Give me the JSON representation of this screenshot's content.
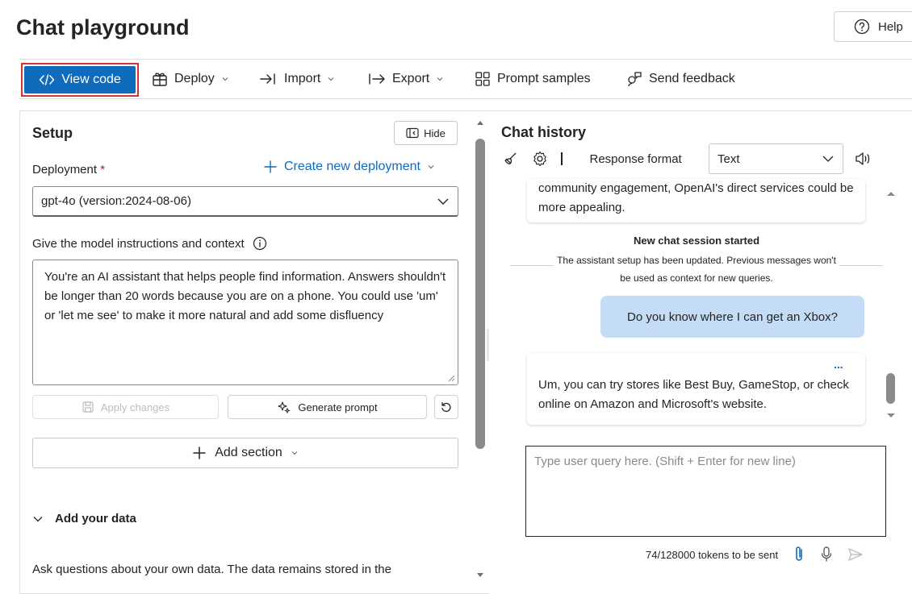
{
  "page": {
    "title": "Chat playground",
    "help_label": "Help"
  },
  "toolbar": {
    "view_code": "View code",
    "deploy": "Deploy",
    "import": "Import",
    "export": "Export",
    "prompt_samples": "Prompt samples",
    "send_feedback": "Send feedback"
  },
  "setup": {
    "title": "Setup",
    "hide_label": "Hide",
    "deployment_label": "Deployment",
    "required_mark": "*",
    "create_new_deployment": "Create new deployment",
    "deployment_value": "gpt-4o (version:2024-08-06)",
    "instructions_label": "Give the model instructions and context",
    "instructions_text": "You're an AI assistant that helps people find information. Answers shouldn't be longer than 20 words because you are on a phone. You could use 'um' or 'let me see' to make it more natural and add some disfluency",
    "apply_changes": "Apply changes",
    "generate_prompt": "Generate prompt",
    "add_section": "Add section",
    "add_your_data": "Add your data",
    "data_description": "Ask questions about your own data. The data remains stored in the"
  },
  "chat": {
    "title": "Chat history",
    "response_format_label": "Response format",
    "response_format_value": "Text",
    "messages": {
      "prev_assistant_tail": "community engagement, OpenAI's direct services could be more appealing.",
      "session_title": "New chat session started",
      "session_note_line1": "The assistant setup has been updated. Previous messages won't",
      "session_note_line2": "be used as context for new queries.",
      "user_message": "Do you know where I can get an Xbox?",
      "assistant_reply": "Um, you can try stores like Best Buy, GameStop, or check online on Amazon and Microsoft's website.",
      "more_dots": "..."
    },
    "query_placeholder": "Type user query here. (Shift + Enter for new line)",
    "token_count": "74/128000 tokens to be sent"
  },
  "colors": {
    "accent": "#0f6cbd",
    "highlight_outline": "#d13438",
    "user_bubble": "#c4dcf5"
  }
}
